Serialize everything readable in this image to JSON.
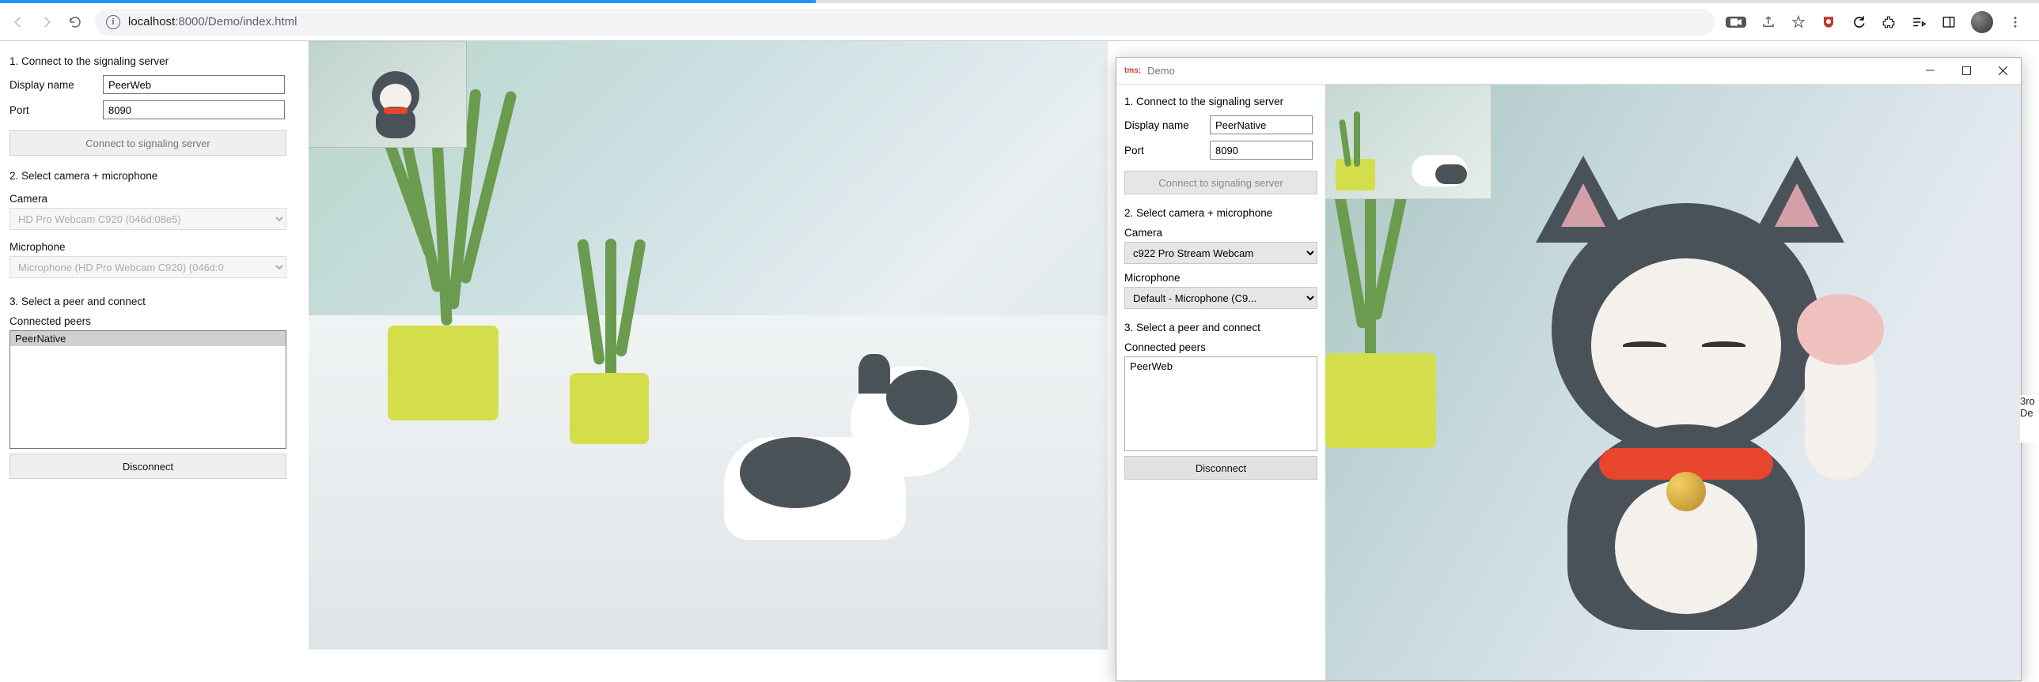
{
  "chrome": {
    "url_host": "localhost",
    "url_port": ":8000",
    "url_path": "/Demo/index.html"
  },
  "web": {
    "step1": "1. Connect to the signaling server",
    "display_name_label": "Display name",
    "display_name_value": "PeerWeb",
    "port_label": "Port",
    "port_value": "8090",
    "connect_btn": "Connect to signaling server",
    "step2": "2. Select camera + microphone",
    "camera_label": "Camera",
    "camera_value": "HD Pro Webcam C920 (046d:08e5)",
    "mic_label": "Microphone",
    "mic_value": "Microphone (HD Pro Webcam C920) (046d:0",
    "step3": "3. Select a peer and connect",
    "peers_label": "Connected peers",
    "peers": [
      "PeerNative"
    ],
    "disconnect_btn": "Disconnect"
  },
  "native": {
    "title_prefix": "tms;",
    "title": "Demo",
    "step1": "1. Connect to the signaling server",
    "display_name_label": "Display name",
    "display_name_value": "PeerNative",
    "port_label": "Port",
    "port_value": "8090",
    "connect_btn": "Connect to signaling server",
    "step2": "2. Select camera + microphone",
    "camera_label": "Camera",
    "camera_value": "c922 Pro Stream Webcam",
    "mic_label": "Microphone",
    "mic_value": "Default - Microphone (C9...",
    "step3": "3. Select a peer and connect",
    "peers_label": "Connected peers",
    "peers": [
      "PeerWeb"
    ],
    "disconnect_btn": "Disconnect"
  },
  "right_edge": {
    "line1": "3ro",
    "line2": "De"
  }
}
